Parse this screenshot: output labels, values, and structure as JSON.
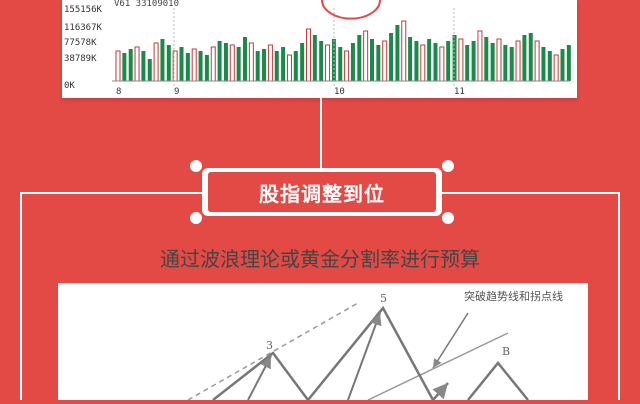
{
  "volume_chart": {
    "header": "V61 33109010",
    "y_ticks": [
      "155156K",
      "116367K",
      "77578K",
      "38789K",
      "0K"
    ],
    "x_ticks": [
      "8",
      "9",
      "10",
      "11"
    ],
    "up_color": "#1a8a4a",
    "down_color": "#c23a3a"
  },
  "section": {
    "title": "股指调整到位",
    "subtitle": "通过波浪理论或黄金分割率进行预算"
  },
  "wave_diagram": {
    "labels": [
      "3",
      "5",
      "B"
    ],
    "annotation": "突破趋势线和拐点线"
  }
}
